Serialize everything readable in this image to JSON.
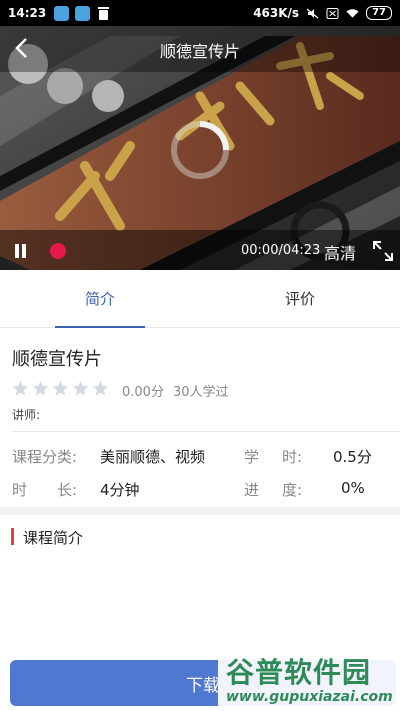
{
  "status_bar": {
    "time": "14:23",
    "net_speed": "463K/s",
    "battery": "77"
  },
  "video": {
    "title": "顺德宣传片",
    "time_display": "00:00/04:23",
    "quality": "高清"
  },
  "tabs": [
    {
      "label": "简介",
      "active": true
    },
    {
      "label": "评价",
      "active": false
    }
  ],
  "course": {
    "title": "顺德宣传片",
    "rating": 0,
    "score": "0.00分",
    "learners": "30人学过",
    "teacher_label": "讲师:",
    "category_label": "课程分类:",
    "category_value": "美丽顺德、视频",
    "hours_label_1": "学",
    "hours_label_2": "时:",
    "hours_value": "0.5分",
    "duration_label_1": "时",
    "duration_label_2": "长:",
    "duration_value": "4分钟",
    "progress_label_1": "进",
    "progress_label_2": "度:",
    "progress_value": "0%"
  },
  "section": {
    "intro_title": "课程简介"
  },
  "download_button": {
    "label": "下载"
  },
  "watermark": {
    "title": "谷普软件园",
    "url": "www.gupuxiazai.com"
  },
  "colors": {
    "accent": "#3b62b5",
    "button": "#4f79d0",
    "record": "#e8194b",
    "section_bar": "#d9463d"
  }
}
